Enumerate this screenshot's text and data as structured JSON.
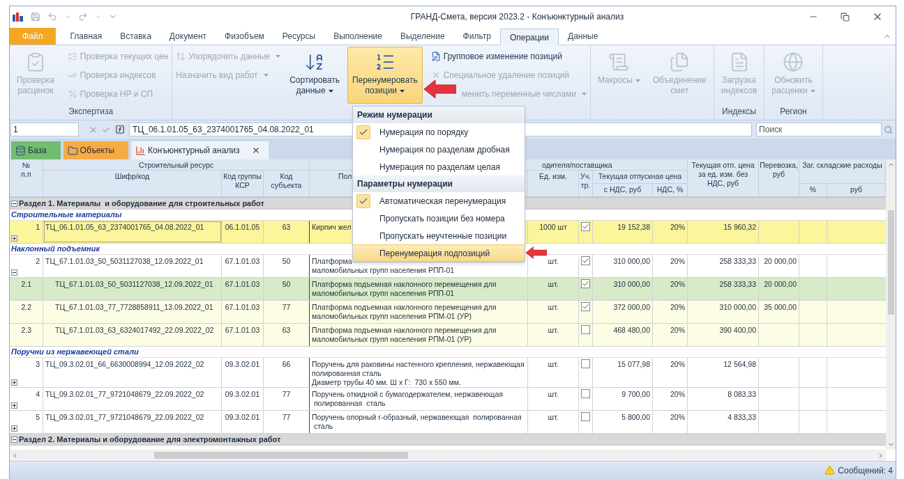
{
  "window": {
    "title": "ГРАНД-Смета, версия 2023.2 - Конъюнктурный анализ"
  },
  "ribbon_tabs": [
    {
      "label": "Файл",
      "kind": "file",
      "selected": false
    },
    {
      "label": "Главная",
      "kind": "tab",
      "selected": false
    },
    {
      "label": "Вставка",
      "kind": "tab",
      "selected": false
    },
    {
      "label": "Документ",
      "kind": "tab",
      "selected": false
    },
    {
      "label": "Физобъем",
      "kind": "tab",
      "selected": false
    },
    {
      "label": "Ресурсы",
      "kind": "tab",
      "selected": false
    },
    {
      "label": "Выполнение",
      "kind": "tab",
      "selected": false
    },
    {
      "label": "Выделение",
      "kind": "tab",
      "selected": false
    },
    {
      "label": "Фильтр",
      "kind": "tab",
      "selected": false
    },
    {
      "label": "Операции",
      "kind": "tab",
      "selected": true
    },
    {
      "label": "Данные",
      "kind": "tab",
      "selected": false
    }
  ],
  "ribbon_groups": [
    {
      "label": "Экспертиза",
      "items": [
        {
          "kind": "large",
          "label": "Проверка\nрасценок",
          "disabled": true,
          "dropdown": false,
          "open": false
        },
        {
          "kind": "stack",
          "items": [
            {
              "kind": "icon",
              "label": "Проверка текущих цен",
              "disabled": true,
              "dropdown": false
            },
            {
              "kind": "icon",
              "label": "Проверка индексов",
              "disabled": true,
              "dropdown": false
            },
            {
              "kind": "icon",
              "label": "Проверка НР и СП",
              "disabled": true,
              "dropdown": false
            }
          ]
        }
      ]
    },
    {
      "items": [
        {
          "kind": "stack",
          "items": [
            {
              "kind": "icon",
              "label": "Упорядочить данные",
              "disabled": true,
              "dropdown": true
            },
            {
              "kind": "plain",
              "label": "Назначить вид работ",
              "disabled": true,
              "dropdown": true
            }
          ]
        },
        {
          "kind": "large",
          "label": "Сортировать\nданные",
          "disabled": false,
          "dropdown": true,
          "open": false
        },
        {
          "kind": "large",
          "label": "Перенумеровать\nпозиции",
          "disabled": false,
          "dropdown": true,
          "open": true
        },
        {
          "kind": "stack",
          "items": [
            {
              "kind": "icon",
              "label": "Групповое изменение позиций",
              "disabled": false,
              "dropdown": false
            },
            {
              "kind": "icon",
              "label": "Специальное удаление позиций",
              "disabled": true,
              "dropdown": false
            },
            {
              "kind": "covered",
              "label": "менить переменные числами",
              "disabled": true,
              "dropdown": true
            }
          ]
        }
      ]
    },
    {
      "items": [
        {
          "kind": "large",
          "label": "Макросы",
          "disabled": true,
          "dropdown": true,
          "open": false
        },
        {
          "kind": "large",
          "label": "Объединение\nсмет",
          "disabled": true,
          "dropdown": false,
          "open": false
        }
      ]
    },
    {
      "label": "Индексы",
      "items": [
        {
          "kind": "large",
          "label": "Загрузка\nиндексов",
          "disabled": true,
          "dropdown": false,
          "open": false
        }
      ]
    },
    {
      "label": "Регион",
      "items": [
        {
          "kind": "large",
          "label": "Обновить\nрасценки",
          "disabled": true,
          "dropdown": true,
          "open": false
        }
      ]
    }
  ],
  "formula_bar": {
    "cell": "1",
    "formula": "ТЦ_06.1.01.05_63_2374001765_04.08.2022_01"
  },
  "search": {
    "placeholder": "Поиск"
  },
  "doc_tabs": [
    {
      "label": "База",
      "color": "#72bd6f",
      "selected": false,
      "closable": false
    },
    {
      "label": "Объекты",
      "color": "#f7ab45",
      "selected": false,
      "closable": false
    },
    {
      "label": "Конъюнктурный анализ",
      "selected": true,
      "closable": true
    }
  ],
  "menu": {
    "sections": [
      {
        "title": "Режим нумерации",
        "items": [
          {
            "label": "Нумерация по порядку",
            "checked": true,
            "highlighted": false
          },
          {
            "label": "Нумерация по разделам дробная",
            "checked": false,
            "highlighted": false
          },
          {
            "label": "Нумерация по разделам целая",
            "checked": false,
            "highlighted": false
          }
        ]
      },
      {
        "title": "Параметры нумерации",
        "items": [
          {
            "label": "Автоматическая перенумерация",
            "checked": true,
            "highlighted": false
          },
          {
            "label": "Пропускать позиции без номера",
            "checked": false,
            "highlighted": false
          },
          {
            "label": "Пропускать неучтенные позиции",
            "checked": false,
            "highlighted": false
          },
          {
            "label": "Перенумерация подпозиций",
            "checked": false,
            "highlighted": true
          }
        ]
      }
    ]
  },
  "table": {
    "header_cells": [
      "№\nп.п",
      "Строительный ресурс",
      "одителя/поставщика",
      "Текущая отп. цена за ед. изм. без НДС, руб",
      "Перевозка, руб",
      "Заг. складские расходы",
      "Шифр/код",
      "Код группы КСР",
      "Код субъекта",
      "Пол",
      "Ед. изм.",
      "Уч. тр.",
      "Текущая отпускная цена",
      "с НДС, руб",
      "НДС, %",
      "%",
      "руб"
    ],
    "rows": [
      {
        "kind": "section",
        "text": "Раздел 1. Материалы  и оборудование для строительных работ",
        "expanded": true
      },
      {
        "kind": "group",
        "text": "Строительные материалы"
      },
      {
        "kind": "item",
        "subposition": false,
        "number": "1",
        "code": "ТЦ_06.1.01.05_63_2374001765_04.08.2022_01",
        "ksr": "06.1.01.05",
        "subject": "63",
        "name": "Кирпич жел",
        "unit": "1000 шт",
        "counted": true,
        "price_vat": "19 152,38",
        "vat": "20%",
        "price": "15 960,32",
        "transport": "",
        "selected": true,
        "expanded": false
      },
      {
        "kind": "group",
        "text": "Наклонный подъемник"
      },
      {
        "kind": "item",
        "subposition": false,
        "number": "2",
        "code": "ТЦ_67.1.01.03_50_5031127038_12.09.2022_01",
        "ksr": "67.1.01.03",
        "subject": "50",
        "name": "Платформа\nмаломобильных групп населения РПП-01",
        "unit": "шт.",
        "counted": true,
        "price_vat": "310 000,00",
        "vat": "20%",
        "price": "258 333,33",
        "transport": "20 000,00",
        "selected": false,
        "expanded": true
      },
      {
        "kind": "item",
        "subposition": true,
        "number": "2.1",
        "code": "ТЦ_67.1.01.03_50_5031127038_12.09.2022_01",
        "ksr": "67.1.01.03",
        "subject": "50",
        "name": "Платформа подъемная наклонного перемещения для маломобильных групп населения РПП-01",
        "unit": "шт.",
        "counted": true,
        "price_vat": "310 000,00",
        "vat": "20%",
        "price": "258 333,33",
        "transport": "20 000,00",
        "selected": false,
        "chosen": true
      },
      {
        "kind": "item",
        "subposition": true,
        "number": "2.2",
        "code": "ТЦ_67.1.01.03_77_7728858911_13.09.2022_01",
        "ksr": "67.1.01.03",
        "subject": "77",
        "name": "Платформа подъемная наклонного перемещения для маломобильных групп населения РПМ-01 (УР)",
        "unit": "шт.",
        "counted": true,
        "price_vat": "372 000,00",
        "vat": "20%",
        "price": "310 000,00",
        "transport": "35 000,00",
        "selected": false,
        "chosen": false
      },
      {
        "kind": "item",
        "subposition": true,
        "number": "2.3",
        "code": "ТЦ_67.1.01.03_63_6324017492_22.09.2022_02",
        "ksr": "67.1.01.03",
        "subject": "63",
        "name": "Платформа подъемная наклонного перемещения для маломобильных групп населения РПМ-01 (УР)",
        "unit": "шт.",
        "counted": false,
        "price_vat": "468 480,00",
        "vat": "20%",
        "price": "390 400,00",
        "transport": "",
        "selected": false,
        "chosen": false
      },
      {
        "kind": "group",
        "text": "Поручни из нержавеющей стали"
      },
      {
        "kind": "item",
        "subposition": false,
        "number": "3",
        "code": "ТЦ_09.3.02.01_66_6630008994_12.09.2022_02",
        "ksr": "09.3.02.01",
        "subject": "66",
        "name": "Поручень для раковины настенного крепления, нержавеющая полированная сталь\nДиаметр трубы 40 мм. Ш х Г:  730 х 550 мм.",
        "unit": "шт.",
        "counted": false,
        "price_vat": "15 077,98",
        "vat": "20%",
        "price": "12 564,98",
        "transport": "",
        "selected": false,
        "expanded": false
      },
      {
        "kind": "item",
        "subposition": false,
        "number": "4",
        "code": "ТЦ_09.3.02.01_77_9721048679_22.09.2022_02",
        "ksr": "09.3.02.01",
        "subject": "77",
        "name": "Поручень откидной с бумагодержателем, нержавеющая\n полированная  сталь",
        "unit": "шт.",
        "counted": false,
        "price_vat": "9 700,00",
        "vat": "20%",
        "price": "8 083,33",
        "transport": "",
        "selected": false,
        "expanded": false
      },
      {
        "kind": "item",
        "subposition": false,
        "number": "5",
        "code": "ТЦ_09.3.02.01_77_9721048679_22.09.2022_02",
        "ksr": "09.3.02.01",
        "subject": "77",
        "name": "Поручень опорный г-образный, нержавеющая  полированная\n сталь",
        "unit": "шт.",
        "counted": false,
        "price_vat": "5 800,00",
        "vat": "20%",
        "price": "4 833,33",
        "transport": "",
        "selected": false,
        "expanded": false
      },
      {
        "kind": "section",
        "text": "Раздел 2. Материалы и оборудование для электромонтажных работ",
        "expanded": true
      }
    ]
  },
  "status_bar": {
    "messages": "Сообщений: 4"
  }
}
